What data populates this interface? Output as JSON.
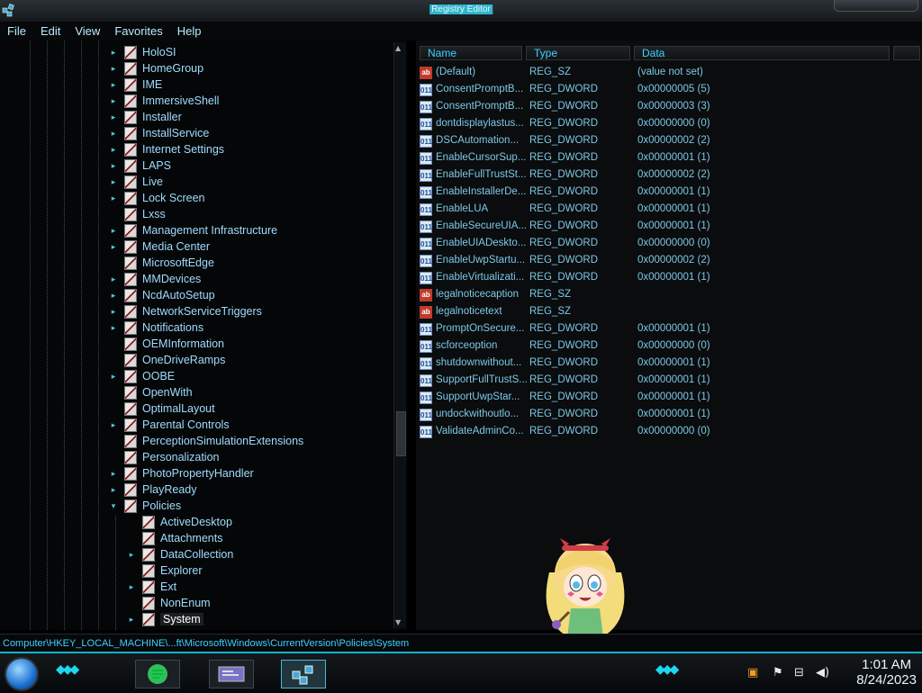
{
  "window": {
    "title": "Registry Editor"
  },
  "menu": [
    "File",
    "Edit",
    "View",
    "Favorites",
    "Help"
  ],
  "tree": {
    "items": [
      {
        "label": "HoloSI",
        "expander": "closed",
        "level": 1
      },
      {
        "label": "HomeGroup",
        "expander": "closed",
        "level": 1
      },
      {
        "label": "IME",
        "expander": "closed",
        "level": 1
      },
      {
        "label": "ImmersiveShell",
        "expander": "closed",
        "level": 1
      },
      {
        "label": "Installer",
        "expander": "closed",
        "level": 1
      },
      {
        "label": "InstallService",
        "expander": "closed",
        "level": 1
      },
      {
        "label": "Internet Settings",
        "expander": "closed",
        "level": 1
      },
      {
        "label": "LAPS",
        "expander": "closed",
        "level": 1
      },
      {
        "label": "Live",
        "expander": "closed",
        "level": 1
      },
      {
        "label": "Lock Screen",
        "expander": "closed",
        "level": 1
      },
      {
        "label": "Lxss",
        "expander": "none",
        "level": 1
      },
      {
        "label": "Management Infrastructure",
        "expander": "closed",
        "level": 1
      },
      {
        "label": "Media Center",
        "expander": "closed",
        "level": 1
      },
      {
        "label": "MicrosoftEdge",
        "expander": "none",
        "level": 1
      },
      {
        "label": "MMDevices",
        "expander": "closed",
        "level": 1
      },
      {
        "label": "NcdAutoSetup",
        "expander": "closed",
        "level": 1
      },
      {
        "label": "NetworkServiceTriggers",
        "expander": "closed",
        "level": 1
      },
      {
        "label": "Notifications",
        "expander": "closed",
        "level": 1
      },
      {
        "label": "OEMInformation",
        "expander": "none",
        "level": 1
      },
      {
        "label": "OneDriveRamps",
        "expander": "none",
        "level": 1
      },
      {
        "label": "OOBE",
        "expander": "closed",
        "level": 1
      },
      {
        "label": "OpenWith",
        "expander": "none",
        "level": 1
      },
      {
        "label": "OptimalLayout",
        "expander": "none",
        "level": 1
      },
      {
        "label": "Parental Controls",
        "expander": "closed",
        "level": 1
      },
      {
        "label": "PerceptionSimulationExtensions",
        "expander": "none",
        "level": 1
      },
      {
        "label": "Personalization",
        "expander": "none",
        "level": 1
      },
      {
        "label": "PhotoPropertyHandler",
        "expander": "closed",
        "level": 1
      },
      {
        "label": "PlayReady",
        "expander": "closed",
        "level": 1
      },
      {
        "label": "Policies",
        "expander": "open",
        "level": 1
      },
      {
        "label": "ActiveDesktop",
        "expander": "none",
        "level": 2
      },
      {
        "label": "Attachments",
        "expander": "none",
        "level": 2
      },
      {
        "label": "DataCollection",
        "expander": "closed",
        "level": 2
      },
      {
        "label": "Explorer",
        "expander": "none",
        "level": 2
      },
      {
        "label": "Ext",
        "expander": "closed",
        "level": 2
      },
      {
        "label": "NonEnum",
        "expander": "none",
        "level": 2
      },
      {
        "label": "System",
        "expander": "closed",
        "level": 2,
        "selected": true
      }
    ]
  },
  "values": {
    "headers": [
      "Name",
      "Type",
      "Data"
    ],
    "rows": [
      {
        "name": "(Default)",
        "type": "REG_SZ",
        "data": "(value not set)",
        "icon": "sz"
      },
      {
        "name": "ConsentPromptB...",
        "type": "REG_DWORD",
        "data": "0x00000005 (5)",
        "icon": "dw"
      },
      {
        "name": "ConsentPromptB...",
        "type": "REG_DWORD",
        "data": "0x00000003 (3)",
        "icon": "dw"
      },
      {
        "name": "dontdisplaylastus...",
        "type": "REG_DWORD",
        "data": "0x00000000 (0)",
        "icon": "dw"
      },
      {
        "name": "DSCAutomation...",
        "type": "REG_DWORD",
        "data": "0x00000002 (2)",
        "icon": "dw"
      },
      {
        "name": "EnableCursorSup...",
        "type": "REG_DWORD",
        "data": "0x00000001 (1)",
        "icon": "dw"
      },
      {
        "name": "EnableFullTrustSt...",
        "type": "REG_DWORD",
        "data": "0x00000002 (2)",
        "icon": "dw"
      },
      {
        "name": "EnableInstallerDe...",
        "type": "REG_DWORD",
        "data": "0x00000001 (1)",
        "icon": "dw"
      },
      {
        "name": "EnableLUA",
        "type": "REG_DWORD",
        "data": "0x00000001 (1)",
        "icon": "dw"
      },
      {
        "name": "EnableSecureUIA...",
        "type": "REG_DWORD",
        "data": "0x00000001 (1)",
        "icon": "dw"
      },
      {
        "name": "EnableUIADeskto...",
        "type": "REG_DWORD",
        "data": "0x00000000 (0)",
        "icon": "dw"
      },
      {
        "name": "EnableUwpStartu...",
        "type": "REG_DWORD",
        "data": "0x00000002 (2)",
        "icon": "dw"
      },
      {
        "name": "EnableVirtualizati...",
        "type": "REG_DWORD",
        "data": "0x00000001 (1)",
        "icon": "dw"
      },
      {
        "name": "legalnoticecaption",
        "type": "REG_SZ",
        "data": "",
        "icon": "sz"
      },
      {
        "name": "legalnoticetext",
        "type": "REG_SZ",
        "data": "",
        "icon": "sz"
      },
      {
        "name": "PromptOnSecure...",
        "type": "REG_DWORD",
        "data": "0x00000001 (1)",
        "icon": "dw"
      },
      {
        "name": "scforceoption",
        "type": "REG_DWORD",
        "data": "0x00000000 (0)",
        "icon": "dw"
      },
      {
        "name": "shutdownwithout...",
        "type": "REG_DWORD",
        "data": "0x00000001 (1)",
        "icon": "dw"
      },
      {
        "name": "SupportFullTrustS...",
        "type": "REG_DWORD",
        "data": "0x00000001 (1)",
        "icon": "dw"
      },
      {
        "name": "SupportUwpStar...",
        "type": "REG_DWORD",
        "data": "0x00000001 (1)",
        "icon": "dw"
      },
      {
        "name": "undockwithoutlo...",
        "type": "REG_DWORD",
        "data": "0x00000001 (1)",
        "icon": "dw"
      },
      {
        "name": "ValidateAdminCo...",
        "type": "REG_DWORD",
        "data": "0x00000000 (0)",
        "icon": "dw"
      }
    ]
  },
  "statusbar": {
    "path": "Computer\\HKEY_LOCAL_MACHINE\\...ft\\Microsoft\\Windows\\CurrentVersion\\Policies\\System"
  },
  "taskbar": {
    "clock_time": "1:01 AM",
    "clock_date": "8/24/2023",
    "tray_icons": [
      "flag-icon",
      "network-icon",
      "volume-icon"
    ]
  },
  "colors": {
    "accent": "#1ed6ee",
    "tree_text": "#9fdcff",
    "value_text": "#7ec8e8"
  }
}
